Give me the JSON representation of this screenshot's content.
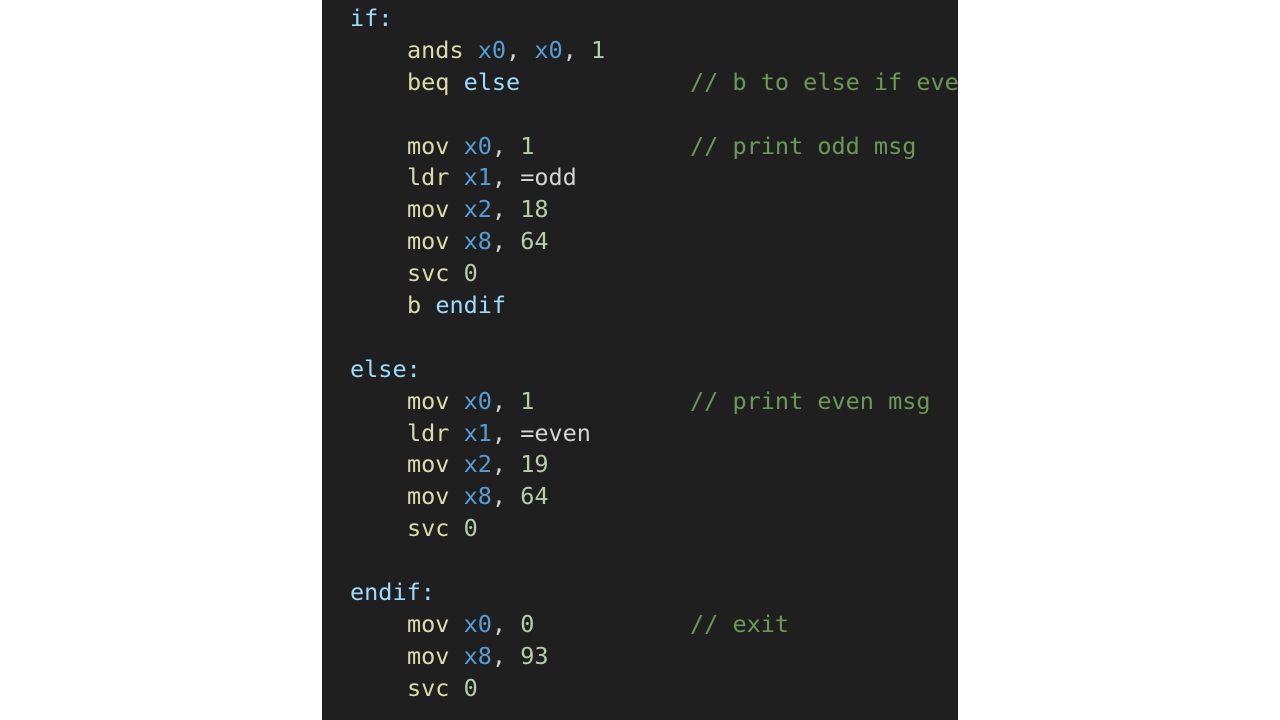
{
  "editor": {
    "colors": {
      "background": "#1f1f1f",
      "page_background": "#ffffff",
      "label": "#9cdcfe",
      "instruction": "#dcdcaa",
      "register": "#569cd6",
      "number": "#b5cea8",
      "text": "#d4d4d4",
      "comment": "#6a9955"
    },
    "lines": [
      {
        "label": "if:"
      },
      {
        "instr": "ands",
        "operands": [
          "x0",
          "x0",
          "1"
        ]
      },
      {
        "instr": "beq",
        "target": "else",
        "comment": "// b to else if even"
      },
      {
        "blank": true
      },
      {
        "instr": "mov",
        "operands": [
          "x0",
          "1"
        ],
        "comment": "// print odd msg"
      },
      {
        "instr": "ldr",
        "operands": [
          "x1",
          "=odd"
        ]
      },
      {
        "instr": "mov",
        "operands": [
          "x2",
          "18"
        ]
      },
      {
        "instr": "mov",
        "operands": [
          "x8",
          "64"
        ]
      },
      {
        "instr": "svc",
        "operands": [
          "0"
        ]
      },
      {
        "instr": "b",
        "target": "endif"
      },
      {
        "blank": true
      },
      {
        "label": "else:"
      },
      {
        "instr": "mov",
        "operands": [
          "x0",
          "1"
        ],
        "comment": "// print even msg"
      },
      {
        "instr": "ldr",
        "operands": [
          "x1",
          "=even"
        ]
      },
      {
        "instr": "mov",
        "operands": [
          "x2",
          "19"
        ]
      },
      {
        "instr": "mov",
        "operands": [
          "x8",
          "64"
        ]
      },
      {
        "instr": "svc",
        "operands": [
          "0"
        ]
      },
      {
        "blank": true
      },
      {
        "label": "endif:"
      },
      {
        "instr": "mov",
        "operands": [
          "x0",
          "0"
        ],
        "comment": "// exit"
      },
      {
        "instr": "mov",
        "operands": [
          "x8",
          "93"
        ]
      },
      {
        "instr": "svc",
        "operands": [
          "0"
        ]
      }
    ]
  }
}
